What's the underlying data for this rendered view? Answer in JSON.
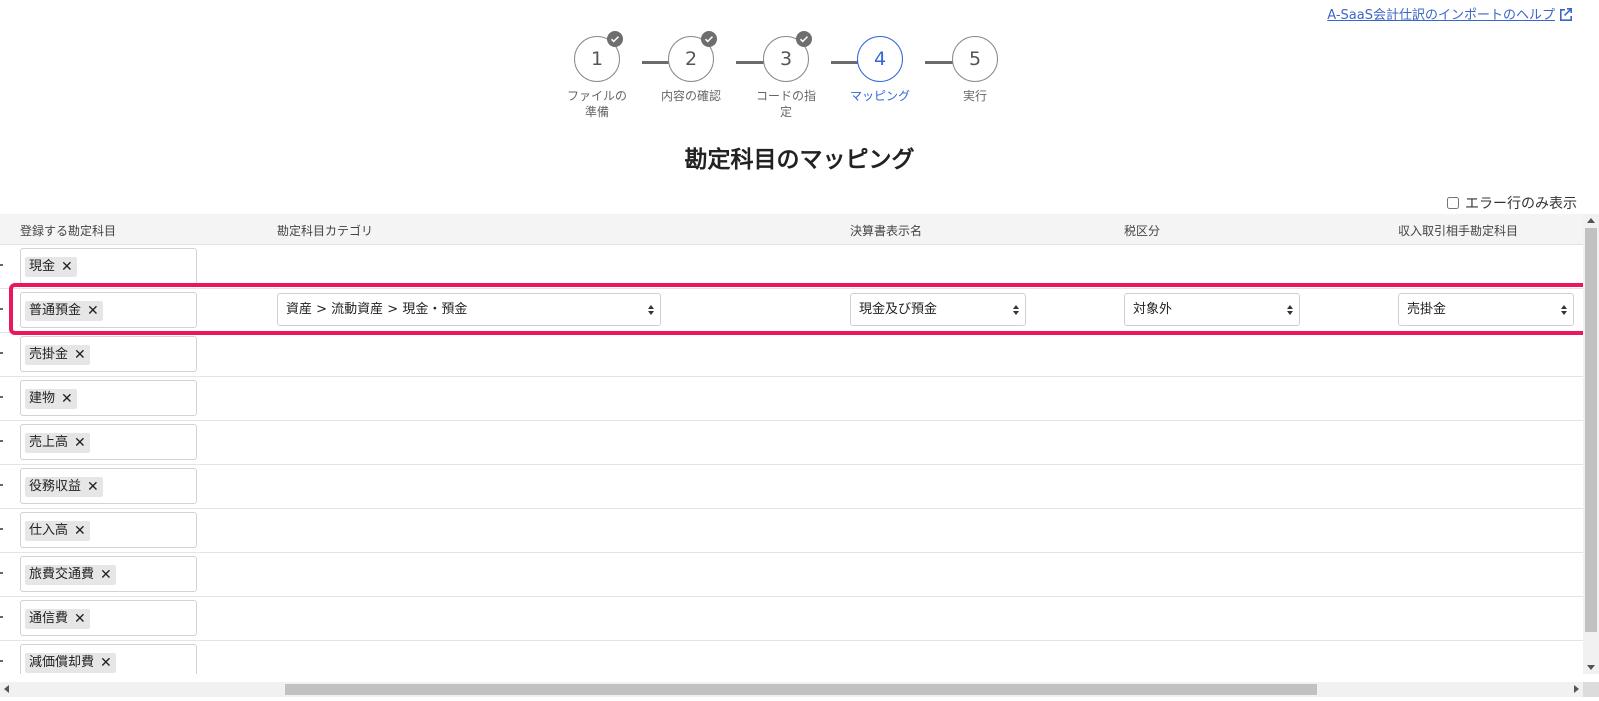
{
  "help_link": {
    "label": "A-SaaS会計仕訳のインポートのヘルプ"
  },
  "stepper": {
    "steps": [
      {
        "number": "1",
        "label": "ファイルの準備",
        "completed": true
      },
      {
        "number": "2",
        "label": "内容の確認",
        "completed": true
      },
      {
        "number": "3",
        "label": "コードの指定",
        "completed": true
      },
      {
        "number": "4",
        "label": "マッピング",
        "completed": false,
        "active": true
      },
      {
        "number": "5",
        "label": "実行",
        "completed": false
      }
    ]
  },
  "page_title": "勘定科目のマッピング",
  "error_filter": {
    "label": "エラー行のみ表示",
    "checked": false
  },
  "table": {
    "headers": [
      "登録する勘定科目",
      "勘定科目カテゴリ",
      "決算書表示名",
      "税区分",
      "収入取引相手勘定科目"
    ],
    "rows": [
      {
        "account": "現金"
      },
      {
        "account": "普通預金",
        "category": "資産 > 流動資産 > 現金・預金",
        "display_name": "現金及び預金",
        "tax": "対象外",
        "counter_account": "売掛金"
      },
      {
        "account": "売掛金"
      },
      {
        "account": "建物"
      },
      {
        "account": "売上高"
      },
      {
        "account": "役務収益"
      },
      {
        "account": "仕入高"
      },
      {
        "account": "旅費交通費"
      },
      {
        "account": "通信費"
      },
      {
        "account": "減価償却費"
      }
    ]
  },
  "colors": {
    "accent": "#3366dd",
    "highlight": "#e8185a",
    "link": "#3a66c8"
  }
}
